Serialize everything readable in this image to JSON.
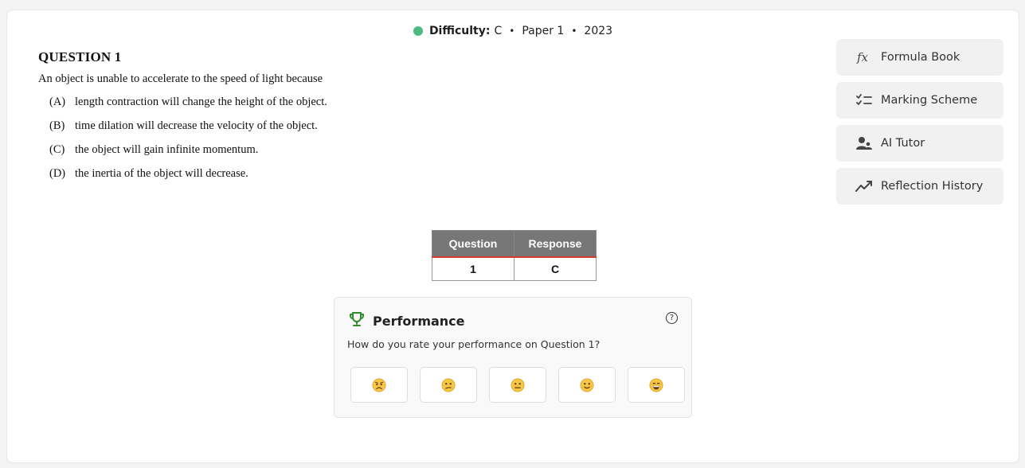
{
  "meta": {
    "difficulty_label": "Difficulty:",
    "difficulty_value": "C",
    "paper": "Paper 1",
    "year": "2023",
    "separator": "•",
    "status_color": "#4cbb7f"
  },
  "question": {
    "title": "QUESTION 1",
    "stem": "An object is unable to accelerate to the speed of light because",
    "options": [
      {
        "letter": "(A)",
        "text": "length contraction will change the height of the object."
      },
      {
        "letter": "(B)",
        "text": "time dilation will decrease the velocity of the object."
      },
      {
        "letter": "(C)",
        "text": "the object will gain infinite momentum."
      },
      {
        "letter": "(D)",
        "text": "the inertia of the object will decrease."
      }
    ]
  },
  "sidebar": {
    "items": [
      {
        "label": "Formula Book",
        "icon": "function-icon"
      },
      {
        "label": "Marking Scheme",
        "icon": "checklist-icon"
      },
      {
        "label": "AI Tutor",
        "icon": "user-group-icon"
      },
      {
        "label": "Reflection History",
        "icon": "trend-line-icon"
      }
    ]
  },
  "response_table": {
    "headers": [
      "Question",
      "Response"
    ],
    "rows": [
      [
        "1",
        "C"
      ]
    ]
  },
  "performance": {
    "title": "Performance",
    "prompt": "How do you rate your performance on Question 1?",
    "help_symbol": "?",
    "accent_color": "#2e8b2e",
    "ratings": [
      "worried-face-icon",
      "confused-face-icon",
      "neutral-face-icon",
      "slight-smile-face-icon",
      "grin-face-icon"
    ]
  }
}
